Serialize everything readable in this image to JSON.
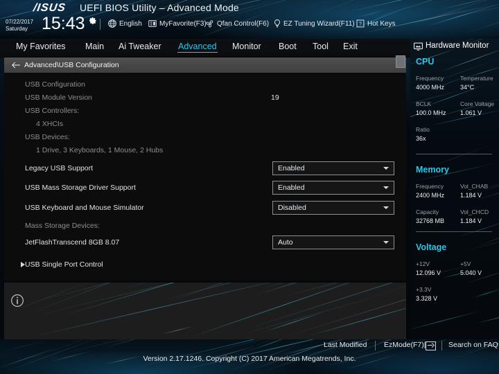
{
  "header": {
    "brand": "/ISUS",
    "title": "UEFI BIOS Utility – Advanced Mode",
    "date": "07/22/2017",
    "weekday": "Saturday",
    "time": "15:43",
    "gear_icon": "gear-icon",
    "items": [
      {
        "label": "English",
        "icon": "globe-icon"
      },
      {
        "label": "MyFavorite(F3)",
        "icon": "list-icon"
      },
      {
        "label": "Qfan Control(F6)",
        "icon": "fan-icon"
      },
      {
        "label": "EZ Tuning Wizard(F11)",
        "icon": "bulb-icon"
      },
      {
        "label": "Hot Keys",
        "icon": "question-box-icon"
      }
    ]
  },
  "tabs": [
    {
      "label": "My Favorites",
      "active": false
    },
    {
      "label": "Main",
      "active": false
    },
    {
      "label": "Ai Tweaker",
      "active": false
    },
    {
      "label": "Advanced",
      "active": true
    },
    {
      "label": "Monitor",
      "active": false
    },
    {
      "label": "Boot",
      "active": false
    },
    {
      "label": "Tool",
      "active": false
    },
    {
      "label": "Exit",
      "active": false
    }
  ],
  "breadcrumb": {
    "back_icon": "back-arrow-icon",
    "path": "Advanced\\USB Configuration"
  },
  "main": {
    "rows": [
      {
        "label": "USB Configuration",
        "dim": true,
        "indent": false,
        "type": "heading",
        "value": ""
      },
      {
        "label": "USB Module Version",
        "dim": true,
        "indent": false,
        "type": "text",
        "value": "19"
      },
      {
        "label": "USB Controllers:",
        "dim": true,
        "indent": false,
        "type": "text",
        "value": ""
      },
      {
        "label": "4 XHCIs",
        "dim": true,
        "indent": true,
        "type": "text",
        "value": ""
      },
      {
        "label": "USB Devices:",
        "dim": true,
        "indent": false,
        "type": "text",
        "value": ""
      },
      {
        "label": "1 Drive, 3 Keyboards, 1 Mouse, 2 Hubs",
        "dim": true,
        "indent": true,
        "type": "text",
        "value": ""
      },
      {
        "label": "Legacy USB Support",
        "dim": false,
        "indent": false,
        "type": "combo",
        "value": "Enabled"
      },
      {
        "label": "USB Mass Storage Driver Support",
        "dim": false,
        "indent": false,
        "type": "combo",
        "value": "Enabled"
      },
      {
        "label": "USB Keyboard and Mouse Simulator",
        "dim": false,
        "indent": false,
        "type": "combo",
        "value": "Disabled"
      },
      {
        "label": "Mass Storage Devices:",
        "dim": true,
        "indent": false,
        "type": "text",
        "value": ""
      },
      {
        "label": "JetFlashTranscend 8GB 8.07",
        "dim": false,
        "indent": false,
        "type": "combo",
        "value": "Auto"
      },
      {
        "label": "USB Single Port Control",
        "dim": false,
        "indent": false,
        "type": "submenu",
        "value": ""
      }
    ],
    "info_icon": "info-icon",
    "scrollbar": "vertical-scrollbar"
  },
  "hardware_monitor": {
    "title": "Hardware Monitor",
    "icon": "monitor-icon",
    "sections": [
      {
        "name": "CPU",
        "pairs": [
          {
            "k": "Frequency",
            "v": "4000 MHz"
          },
          {
            "k": "Temperature",
            "v": "34°C"
          },
          {
            "k": "BCLK",
            "v": "100.0 MHz"
          },
          {
            "k": "Core Voltage",
            "v": "1.061 V"
          },
          {
            "k": "Ratio",
            "v": "36x"
          }
        ]
      },
      {
        "name": "Memory",
        "pairs": [
          {
            "k": "Frequency",
            "v": "2400 MHz"
          },
          {
            "k": "Vol_CHAB",
            "v": "1.184 V"
          },
          {
            "k": "Capacity",
            "v": "32768 MB"
          },
          {
            "k": "Vol_CHCD",
            "v": "1.184 V"
          }
        ]
      },
      {
        "name": "Voltage",
        "pairs": [
          {
            "k": "+12V",
            "v": "12.096 V"
          },
          {
            "k": "+5V",
            "v": "5.040 V"
          },
          {
            "k": "+3.3V",
            "v": "3.328 V"
          }
        ]
      }
    ]
  },
  "footer": {
    "last_modified": "Last Modified",
    "ezmode": "EzMode(F7)|",
    "ezmode_icon": "exit-arrow-icon",
    "search": "Search on FAQ",
    "version": "Version 2.17.1246. Copyright (C) 2017 American Megatrends, Inc."
  },
  "colors": {
    "accent": "#2fc6e8",
    "panel_bg": "#0c0c0c",
    "breadcrumb_bg": "#474747",
    "text": "#dfe3e6",
    "dim_text": "#8b8f93"
  }
}
